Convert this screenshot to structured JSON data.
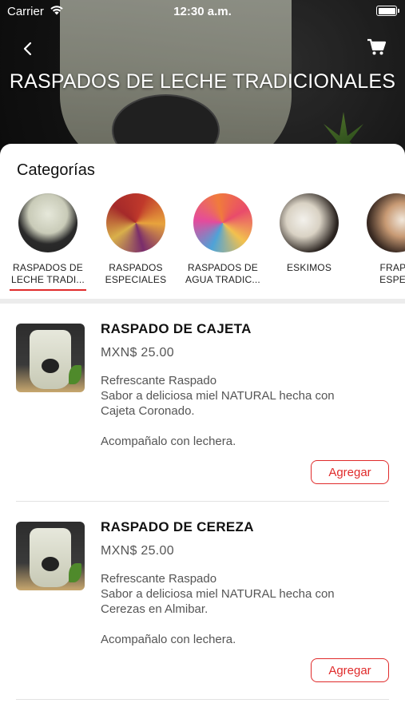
{
  "status_bar": {
    "carrier": "Carrier",
    "time": "12:30 a.m."
  },
  "header": {
    "title": "RASPADOS DE LECHE TRADICIONALES",
    "back_icon": "chevron-left-icon",
    "cart_icon": "cart-icon"
  },
  "categories": {
    "heading": "Categorías",
    "items": [
      {
        "label": "RASPADOS DE\nLECHE TRADI...",
        "selected": true
      },
      {
        "label": "RASPADOS\nESPECIALES",
        "selected": false
      },
      {
        "label": "RASPADOS DE\nAGUA TRADIC...",
        "selected": false
      },
      {
        "label": "ESKIMOS",
        "selected": false
      },
      {
        "label": "FRAPP\nESPEC",
        "selected": false
      }
    ]
  },
  "products": [
    {
      "name": "RASPADO DE CAJETA",
      "price": "MXN$ 25.00",
      "description": "Refrescante Raspado\nSabor a deliciosa miel NATURAL hecha con\nCajeta Coronado.\n\nAcompañalo con lechera.",
      "add_label": "Agregar"
    },
    {
      "name": "RASPADO DE CEREZA",
      "price": "MXN$ 25.00",
      "description": "Refrescante Raspado\nSabor a deliciosa miel NATURAL hecha con\nCerezas en Almibar.\n\nAcompañalo con lechera.",
      "add_label": "Agregar"
    }
  ],
  "colors": {
    "accent": "#e02b2b",
    "header_bg": "#1d1d1d"
  }
}
